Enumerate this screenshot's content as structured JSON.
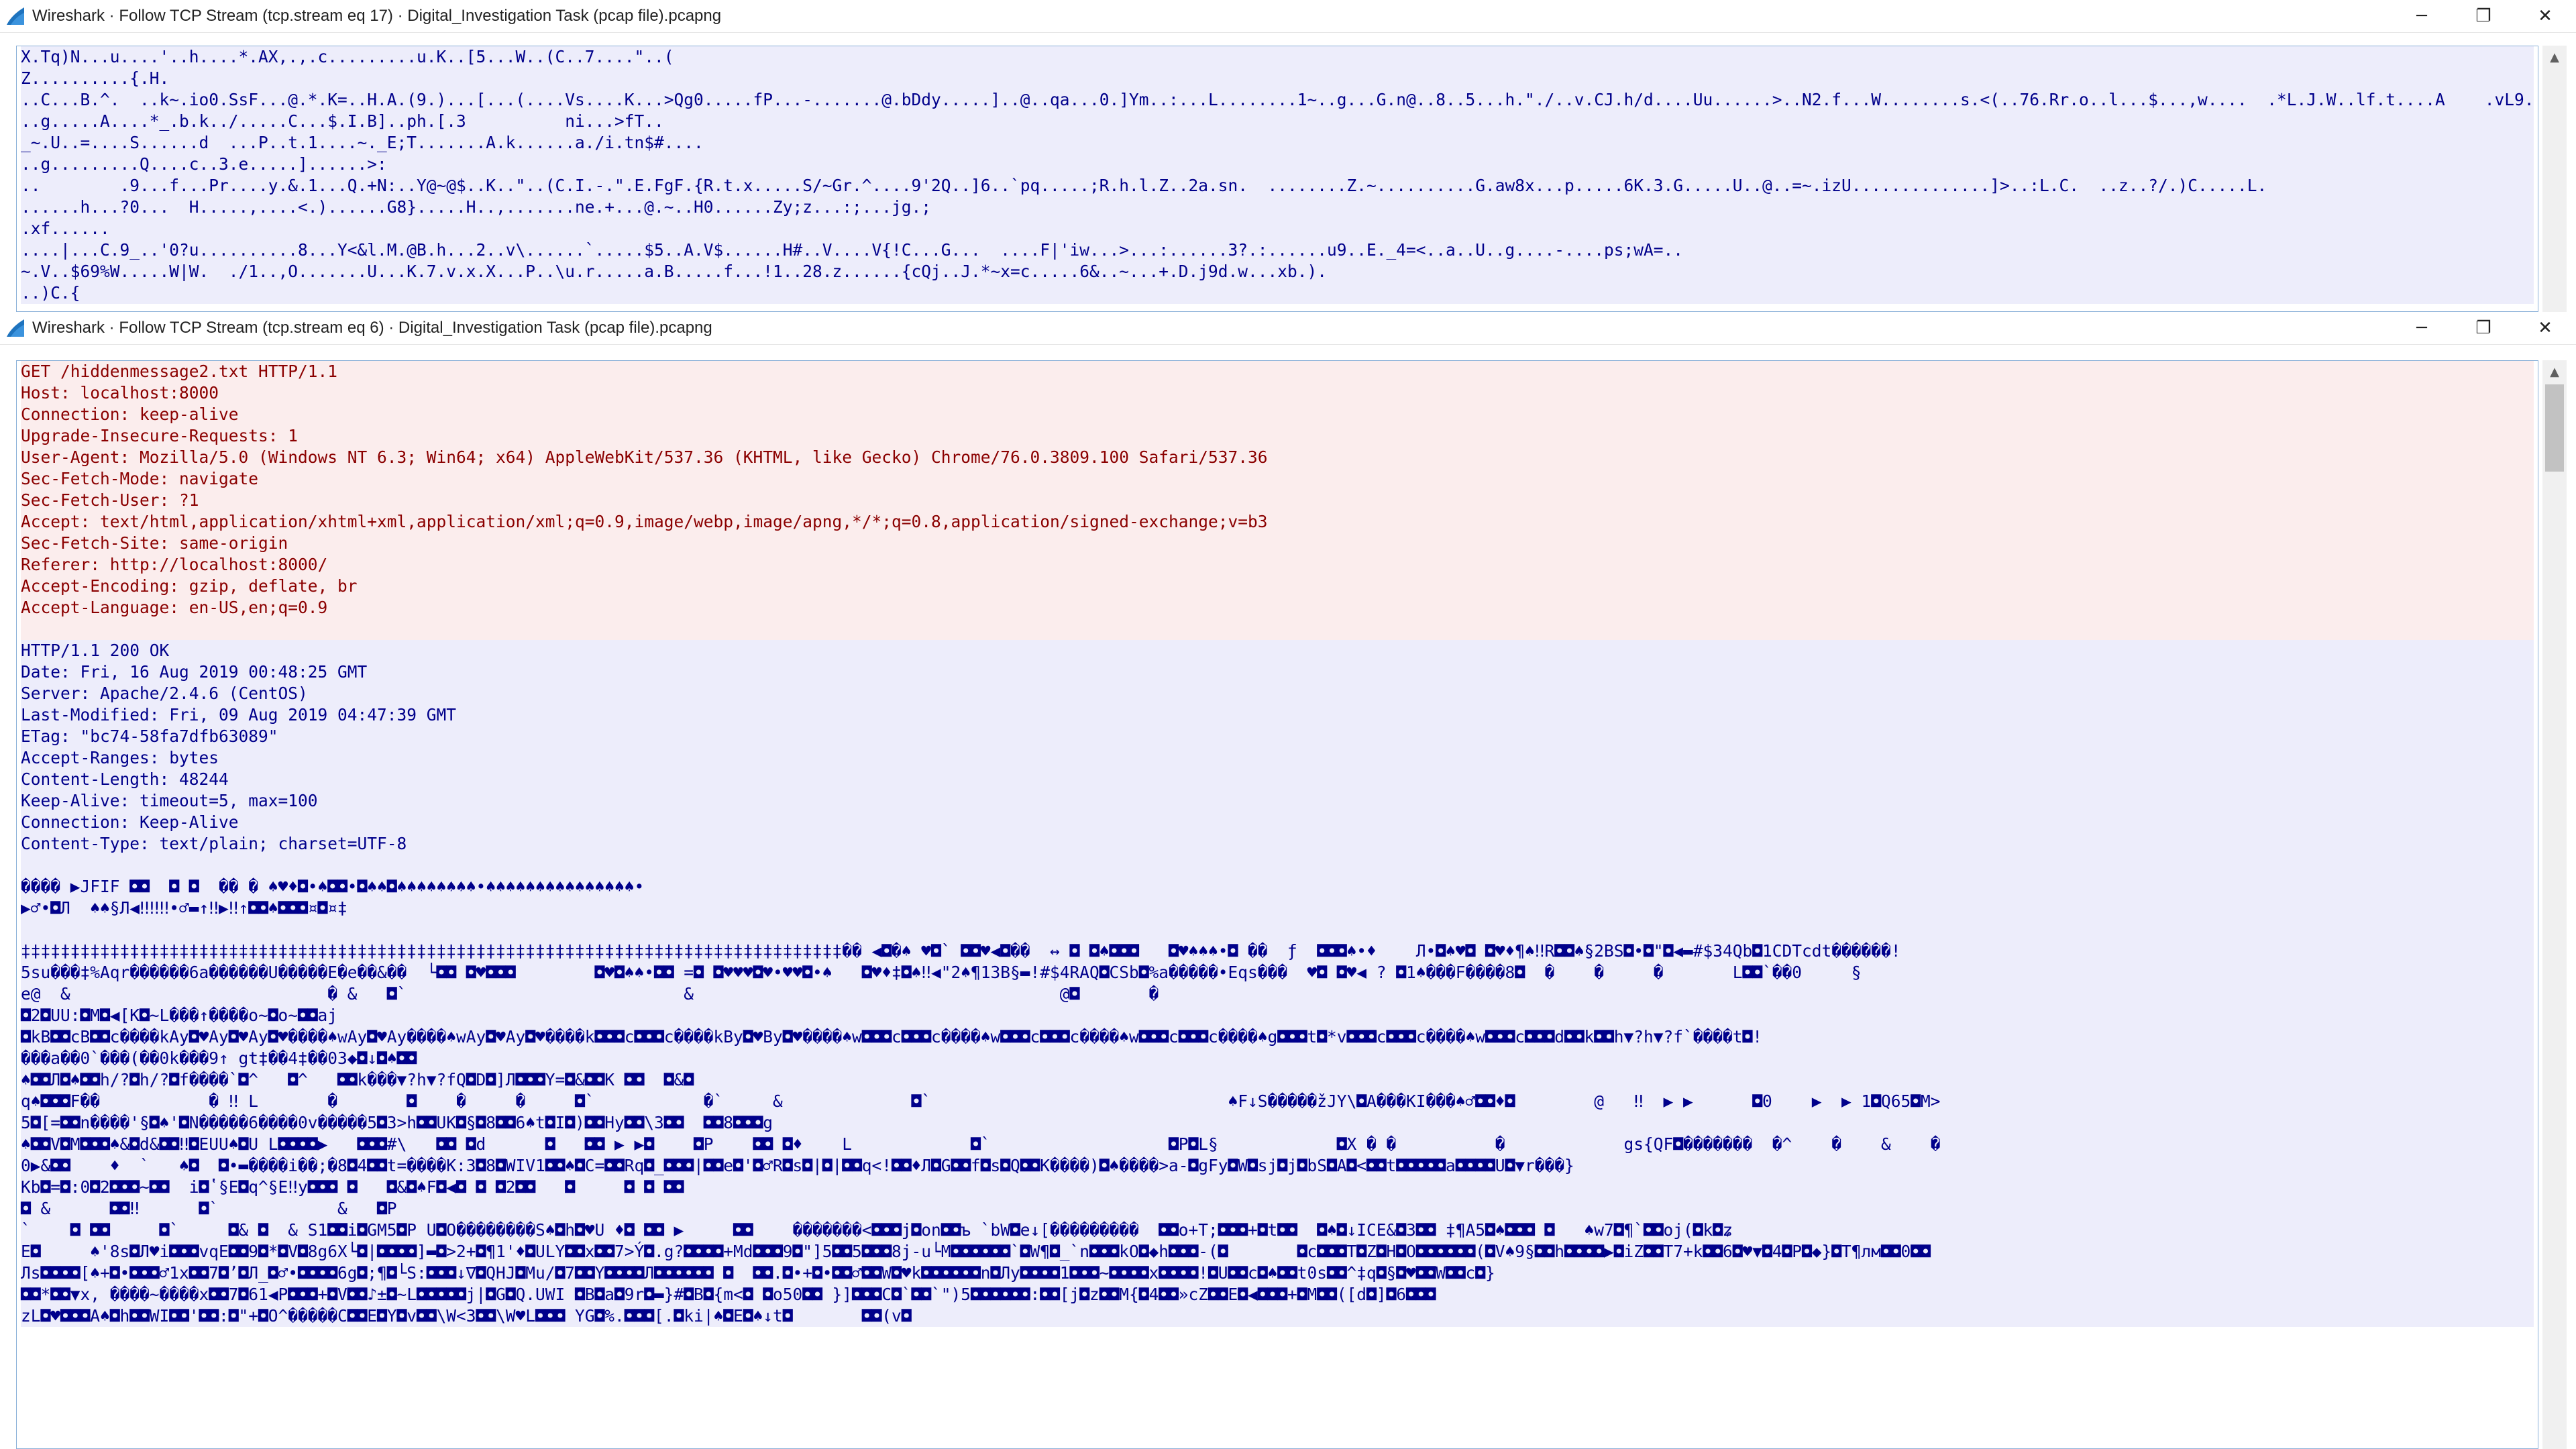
{
  "window1": {
    "title": "Wireshark · Follow TCP Stream (tcp.stream eq 17) · Digital_Investigation Task (pcap file).pcapng",
    "lines": [
      "X.Tq)N...u....'..h....*.AX,.,.c.........u.K..[5...W..(C..7....\"..(",
      "Z..........{.H.",
      "..C...B.^.  ..k~.io0.SsF...@.*.K=..H.A.(9.)...[...(....Vs....K...>Qg0.....fP...-.......@.bDdy.....]..@..qa...0.]Ym..:...L........1~..g...G.n@..8..5...h.\"./..v.CJ.h/d....Uu......>..N2.f...W........s.<(..76.Rr.o..l...$...,w....  .*L.J.W..lf.t....A    .vL9..",
      "..g.....A....*_.b.k../.....C...$.I.B]..ph.[.3          ni...>fT..",
      "_~.U..=....S......d  ...P..t.1....~._E;T.......A.k......a./i.tn$#....",
      "..g.........Q....c..3.e.....]......>:",
      "..        .9...f...Pr....y.&.1...Q.+N:..Y@~@$..K..\"..(C.I.-.\".E.FgF.{R.t.x.....S/~Gr.^....9'2Q..]6..`pq.....;R.h.l.Z..2a.sn.  ........Z.~..........G.aw8x...p.....6K.3.G.....U..@..=~.izU..............]>..:L.C.  ..z..?/.)C.....L.",
      "......h...?0...  H.....,....<.)......G8}.....H..,.......ne.+...@.~..H0......Zy;z...:;...jg.;",
      ".xf......",
      "....|...C.9_..'0?u..........8...Y<&l.M.@B.h...2..v\\......`.....$5..A.V$......H#..V....V{!C...G...  ....F|'iw...>...:......3?.:......u9..E._4=<..a..U..g....-....ps;wA=..",
      "~.V..$69%W.....W|W.  ./1..,O.......U...K.7.v.x.X...P..\\u.r.....a.B.....f...!1..28.z......{cQj..J.*~x=c.....6&..~...+.D.j9d.w...xb.).",
      "..)C.{"
    ]
  },
  "window2": {
    "title": "Wireshark · Follow TCP Stream (tcp.stream eq 6) · Digital_Investigation Task (pcap file).pcapng",
    "request_lines": [
      "GET /hiddenmessage2.txt HTTP/1.1",
      "Host: localhost:8000",
      "Connection: keep-alive",
      "Upgrade-Insecure-Requests: 1",
      "User-Agent: Mozilla/5.0 (Windows NT 6.3; Win64; x64) AppleWebKit/537.36 (KHTML, like Gecko) Chrome/76.0.3809.100 Safari/537.36",
      "Sec-Fetch-Mode: navigate",
      "Sec-Fetch-User: ?1",
      "Accept: text/html,application/xhtml+xml,application/xml;q=0.9,image/webp,image/apng,*/*;q=0.8,application/signed-exchange;v=b3",
      "Sec-Fetch-Site: same-origin",
      "Referer: http://localhost:8000/",
      "Accept-Encoding: gzip, deflate, br",
      "Accept-Language: en-US,en;q=0.9"
    ],
    "response_lines": [
      "HTTP/1.1 200 OK",
      "Date: Fri, 16 Aug 2019 00:48:25 GMT",
      "Server: Apache/2.4.6 (CentOS)",
      "Last-Modified: Fri, 09 Aug 2019 04:47:39 GMT",
      "ETag: \"bc74-58fa7dfb63089\"",
      "Accept-Ranges: bytes",
      "Content-Length: 48244",
      "Keep-Alive: timeout=5, max=100",
      "Connection: Keep-Alive",
      "Content-Type: text/plain; charset=UTF-8"
    ],
    "body_lines": [
      "",
      "���� ▶JFIF ◘◘  ◘ ◘  �� � ♠♥♦◘•♠◘◘•◘♠♠◘♠♠♠♠♠♠♠♠•♠♠♠♠♠♠♠♠♠♠♠♠♠♠♠•",
      "▶♂•◘Л  ♠♠§Л◀‼‼‼•♂▬↑‼▶‼↑◘◘♠◘◘◘¤◘¤‡",
      "",
      "‡‡‡‡‡‡‡‡‡‡‡‡‡‡‡‡‡‡‡‡‡‡‡‡‡‡‡‡‡‡‡‡‡‡‡‡‡‡‡‡‡‡‡‡‡‡‡‡‡‡‡‡‡‡‡‡‡‡‡‡‡‡‡‡‡‡‡‡‡‡‡‡‡‡‡‡‡‡‡‡‡‡‡�� ◀◘�♠ ♥◘` ◘◘♥◀◘��  ↔ ◘ ◘♠◘◘◘   ◘♥♠♠♠•◘ ��  ƒ  ◘◘◘♠•♦    Л•◘♠♥◘ ◘♥♦¶♠‼R◘◘♠§2BS◘•◘\"◘◀▬#$34Qb◘1CDTcdt������!",
      "5su���‡%Aqr������6a������U�����E�e��&��  └◘◘ ◘♥◘◘◘        ◘♥◘♠♠•◘◘ =◘ ◘♥♥♥◘♥•♥♥◘•♠   ◘♥♦‡◘♠‼◀\"2♠¶13B§▬!#$4RAQ◘CSb◘%a�����•Eqs���  ♥◘ ◘♥◀ ? ◘1♠���F����8◘  �    �     �       L◘◘`��0     §",
      "e@  &                          � &   ◘`                            &                                     @◘       �",
      "◘2◘UU:◘M◘◀[K◘~L���↑����o~◘o~◘◘aj",
      "◘kB◘◘cB◘◘c����kAy◘♥Ay◘♥Ay◘♥����♠wAy◘♥Ay����♠wAy◘♥Ay◘♥����k◘◘◘c◘◘◘c����kBy◘♥By◘♥����♠w◘◘◘c◘◘◘c����♠w◘◘◘c◘◘◘c����♠w◘◘◘c◘◘◘c����♠g◘◘◘t◘*v◘◘◘c◘◘◘c����♠w◘◘◘c◘◘◘d◘◘k◘◘h▼?h▼?f`����t◘!",
      "���a��0`���(��0k���9↑ gt‡��4‡��03◆◘↓◘♠◘◘",
      "♠◘◘Л◘♠◘◘h/?◘h/?◘f����`◘^   ◘^   ◘◘k���▼?h▼?fQ◘D◘]Л◘◘◘Y=◘&◘◘K ◘◘  ◘&◘",
      "q♠◘◘◘F��           � ‼ L       �       ◘    �     �     ◘`           �`     &             ◘`                              ♠F↓S�����žJY\\◘A���KI���♠♂◘◘♦◘        @   ‼  ▶ ▶      ◘0    ▶  ▶ 1◘Q65◘M>",
      "5◘[=◘◘n����'§◘♠'◘N�����6����0v�����5◘3>h◘◘UK◘§◘8◘◘6♠t◘I◘)◘◘Hy◘◘\\3◘◘  ◘◘8◘◘◘g",
      "♠◘◘V◘M◘◘◘♠&◘d&◘◘‼◘EUU♠◘U L◘◘◘◘▶   ◘◘◘#\\   ◘◘ ◘d      ◘   ◘◘ ▶ ▶◘    ◘P    ◘◘ ◘♦    L            ◘`                  ◘P◘L§            ◘X � �          �            gs{QF◘�������  �^    �    &    �",
      "0▶&◘◘    ♦  `   ♠◘  ◘•▬����i��;�8◘4◘◘t=����K:3◘8◘WIV1◘◘♠◘C=◘◘Rq◘_◘◘◘|◘◘e◘'◘♂R◘s◘|◘|◘◘q<!◘◘♦Л◘G◘◘f◘s◘Q◘◘K����)◘♠����>a-◘gFy◘W◘sj◘j◘bS◘A◘<◘◘t◘◘◘◘◘a◘◘◘◘U◘▼r���}",
      "Kb◘=◘:0◘2◘◘◘~◘◘  i◘ʽ§E◘q^§E‼y◘◘◘ ◘   ◘&◘♠F◘◀◘ ◘ ◘2◘◘   ◘     ◘ ◘ ◘◘",
      "◘ &      ◘◘‼      ◘`            &   ◘P",
      "`    ◘ ◘◘     ◘`     ◘& ◘  & S1◘◘i◘GM5◘P U◘O��������S♠◘h◘♥U ♦◘ ◘◘ ▶     ◘◘    �������<◘◘◘j◘on◘◘ъ `bW◘e↓[���������  ◘◘o+T;◘◘◘+◘t◘◘  ◘♠◘↓ICE&◘3◘◘ ‡¶A5◘♠◘◘◘ ◘   ♠w7◘¶`◘◘oj(◘k◘ʑ",
      "E◘     ♠'8s◘Л♥i◘◘◘vqE◘◘9◘*◘V◘8g6X└◘|◘◘◘◘]▬◘>2+◘¶1'♦◘ULY◘◘x◘◘7>Ý◘.g?◘◘◘◘+Md◘◘◘9◘\"]5◘◘5◘◘◘8j-u└M◘◘◘◘◘◘`◘W¶◘_`n◘◘◘kO◘◆h◘◘◘-(◘       ◘c◘◘◘T◘Z◘H◘O◘◘◘◘◘◘(◘V♠9§◘◘h◘◘◘◘▶◘iZ◘◘T7+k◘◘6◘♥▼◘4◘P◘◆}◘T¶лм◘◘0◘◘",
      "Лs◘◘◘◘[♠+◘•◘◘◘♂1x◘◘7◘ʼ◘Л_◘♂•◘◘◘◘6g◘;¶◘└S:◘◘◘↓∇◘QHJ◘Mu/◘7◘◘Y◘◘◘◘Л◘◘◘◘◘◘ ◘  ◘◘.◘•+◘•◘◘♂◘◘W◘♥k◘◘◘◘◘◘n◘Лy◘◘◘◘1◘◘◘~◘◘◘◘x◘◘◘◘!◘U◘◘c◘♠◘◘t0s◘◘^‡q◘§◘♥◘◘W◘◘c◘}",
      "◘◘*◘◘▼x, ����~����x◘◘7◘61◀P◘◘◘+◘V◘◘♪±◘~L◘◘◘◘◘j|◘G◘Q.UWI ◘B◘a◘9r◘▬}#◘B◘{m<◘ ◘o50◘◘ }]◘◘◘C◘`◘◘`\")5◘◘◘◘◘◘:◘◘[j◘z◘◘M{◘4◘◘»cZ◘◘E◘◀◘◘◘+◘M◘◘([d◘]◘6◘◘◘",
      "zL◘♥◘◘◘A♠◘h◘◘WI◘◘'◘◘:◘\"+◘O^�����C◘◘E◘Y◘v◘◘\\W<3◘◘\\W♥L◘◘◘ YG◘%.◘◘◘[.◘ki|♠◘E◘♠↓t◘       ◘◘(v◘"
    ]
  },
  "controls": {
    "minimize": "─",
    "restore": "❐",
    "close": "✕"
  },
  "scroll_arrows": {
    "up": "▲",
    "down": "▼"
  },
  "colors": {
    "client_text": "#8b0000",
    "client_bg": "#fbeded",
    "server_text": "#00008b",
    "server_bg": "#ededfb",
    "wireshark_fin": "#1e73be"
  }
}
